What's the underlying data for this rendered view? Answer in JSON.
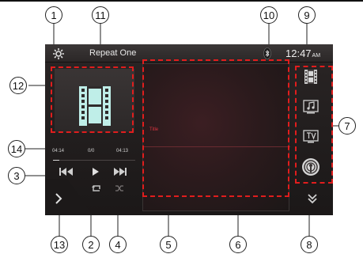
{
  "status_bar": {
    "repeat_mode": "Repeat One",
    "clock_time": "12:47",
    "clock_ampm": "AM",
    "settings_icon": "gear-icon",
    "bluetooth_icon": "bluetooth-icon"
  },
  "player": {
    "elapsed": "04:14",
    "track_count": "0/0",
    "total": "04:13",
    "progress_fraction": 0.08
  },
  "main": {
    "title_label": "Title"
  },
  "controls": [
    "previous-icon",
    "play-icon",
    "next-icon",
    "repeat-icon",
    "shuffle-icon"
  ],
  "sources": [
    "video-icon",
    "music-icon",
    "tv-icon",
    "podcast-icon"
  ],
  "callouts": {
    "c1": "1",
    "c2": "2",
    "c3": "3",
    "c4": "4",
    "c5": "5",
    "c6": "6",
    "c7": "7",
    "c8": "8",
    "c9": "9",
    "c10": "10",
    "c11": "11",
    "c12": "12",
    "c13": "13",
    "c14": "14"
  },
  "colors": {
    "highlight": "#e11d1d",
    "screen_bg": "#231f1f",
    "title_text": "#d7333f"
  }
}
